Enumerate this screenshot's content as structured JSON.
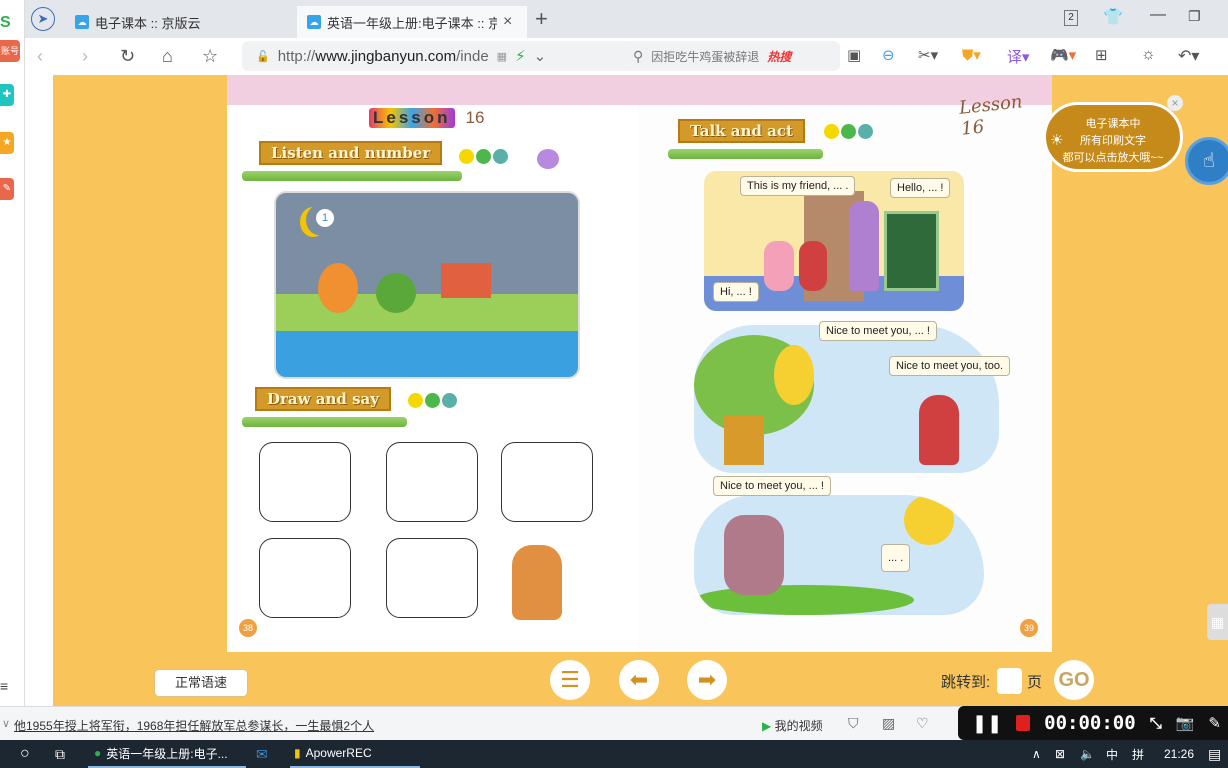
{
  "sidebar": {
    "items": [
      {
        "label": "账号",
        "icon": "account-icon",
        "color": "#e9674b"
      },
      {
        "icon": "plugin-icon",
        "color": "#20c4c0"
      },
      {
        "icon": "star-icon",
        "color": "#f5a623"
      },
      {
        "icon": "tool-icon",
        "color": "#e9674b"
      }
    ]
  },
  "browser": {
    "tabs": [
      {
        "label": "电子课本 :: 京版云",
        "active": false
      },
      {
        "label": "英语一年级上册:电子课本 :: 京",
        "active": true
      }
    ],
    "tab_counter": "2",
    "url_prefix": "http://",
    "url_host": "www.jingbanyun.com",
    "url_rest": "/inde",
    "search_placeholder": "因拒吃牛鸡蛋被辞退",
    "hot_search": "热搜"
  },
  "textbook": {
    "left_page": {
      "lesson_word": "Lesson",
      "lesson_number": "16",
      "section1": "Listen and number",
      "picture_number": "1",
      "section2": "Draw and say",
      "page_number": "38"
    },
    "right_page": {
      "lesson_title": "Lesson 16",
      "section": "Talk and act",
      "bubbles": [
        "This is my friend, ... .",
        "Hello, ... !",
        "Hi, ... !",
        "Nice to meet you, ... !",
        "Nice to meet you, too.",
        "Nice to meet you, ... !",
        "... ."
      ],
      "page_number": "39"
    }
  },
  "tip": {
    "lines": [
      "电子课本中",
      "所有印刷文字",
      "都可以点击放大哦~~"
    ]
  },
  "controls": {
    "speed_label": "正常语速",
    "jump_label": "跳转到:",
    "page_input": "",
    "page_unit": "页",
    "go_label": "GO"
  },
  "statusbar": {
    "news": "他1955年授上将军衔，1968年担任解放军总参谋长，一生最惧2个人",
    "my_video": "我的视频"
  },
  "recorder": {
    "time": "00:00:00"
  },
  "taskbar": {
    "items": [
      {
        "label": "英语一年级上册:电子..."
      },
      {
        "label": ""
      },
      {
        "label": "ApowerREC"
      }
    ],
    "ime1": "中",
    "ime2": "拼",
    "clock": "21:26"
  },
  "colors": {
    "accent_orange": "#f9c55a",
    "board_brown": "#d39a2a",
    "recorder_red": "#e02020"
  }
}
